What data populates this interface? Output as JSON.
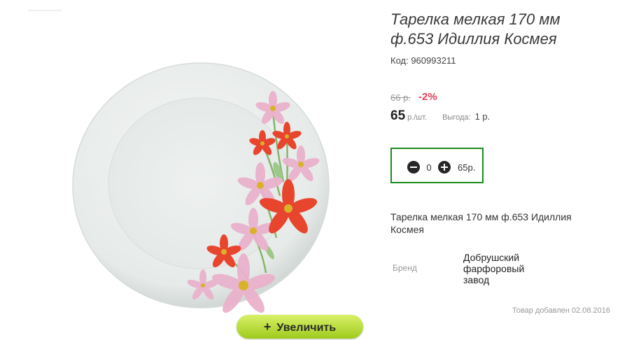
{
  "product": {
    "title": "Тарелка мелкая 170 мм ф.653 Идиллия Космея",
    "code": "Код: 960993211",
    "old_price": "66 р.",
    "discount": "-2%",
    "price": "65",
    "price_unit": "р./шт.",
    "profit_label": "Выгода:",
    "profit_value": "1 р.",
    "description": "Тарелка мелкая 170 мм ф.653 Идиллия Космея",
    "brand_label": "Бренд",
    "brand_value": "Добрушский фарфоровый завод",
    "added": "Товар добавлен 02.08.2016"
  },
  "quantity": {
    "minus_icon": "minus-circle-icon",
    "plus_icon": "plus-circle-icon",
    "value": "0",
    "sum": "65р."
  },
  "image": {
    "zoom_label": "Увеличить",
    "zoom_icon": "plus-icon"
  },
  "colors": {
    "discount": "#e0415b",
    "qty_border": "#1a8a1a",
    "zoom_button": "#b8dc3a",
    "flower_red": "#e8452f",
    "flower_pink": "#eab2cc"
  }
}
